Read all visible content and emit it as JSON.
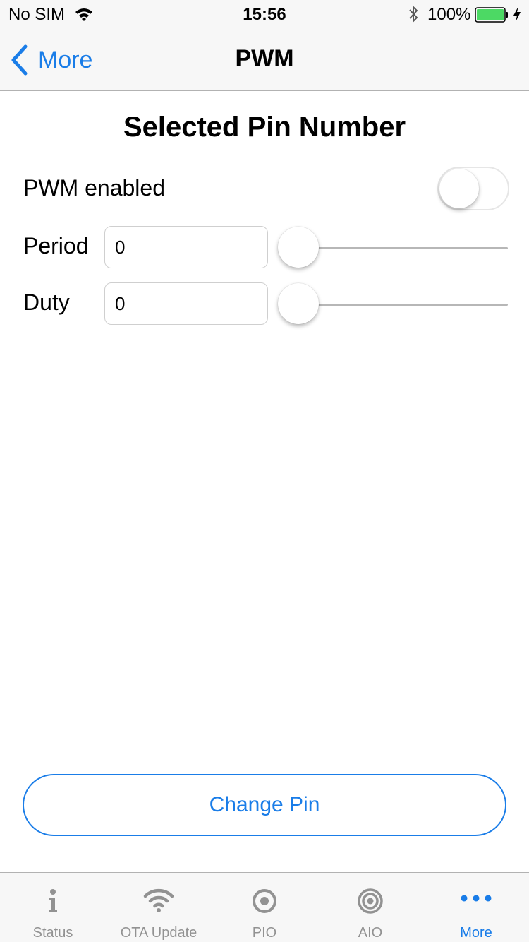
{
  "status_bar": {
    "carrier": "No SIM",
    "time": "15:56",
    "battery_text": "100%",
    "battery_level": 1.0,
    "battery_color": "#4cd964"
  },
  "nav": {
    "back_label": "More",
    "title": "PWM"
  },
  "content": {
    "heading": "Selected Pin Number",
    "pwm_enabled_label": "PWM enabled",
    "pwm_enabled_on": false,
    "period_label": "Period",
    "period_value": "0",
    "period_slider_value": 0,
    "duty_label": "Duty",
    "duty_value": "0",
    "duty_slider_value": 0,
    "change_pin_label": "Change Pin"
  },
  "tabs": [
    {
      "label": "Status",
      "icon": "info-icon",
      "active": false
    },
    {
      "label": "OTA Update",
      "icon": "wifi-icon",
      "active": false
    },
    {
      "label": "PIO",
      "icon": "target-icon",
      "active": false
    },
    {
      "label": "AIO",
      "icon": "double-target-icon",
      "active": false
    },
    {
      "label": "More",
      "icon": "more-dots-icon",
      "active": true
    }
  ],
  "colors": {
    "accent": "#1a7de8",
    "inactive_tab": "#929292",
    "bar_background": "#f7f7f7"
  }
}
